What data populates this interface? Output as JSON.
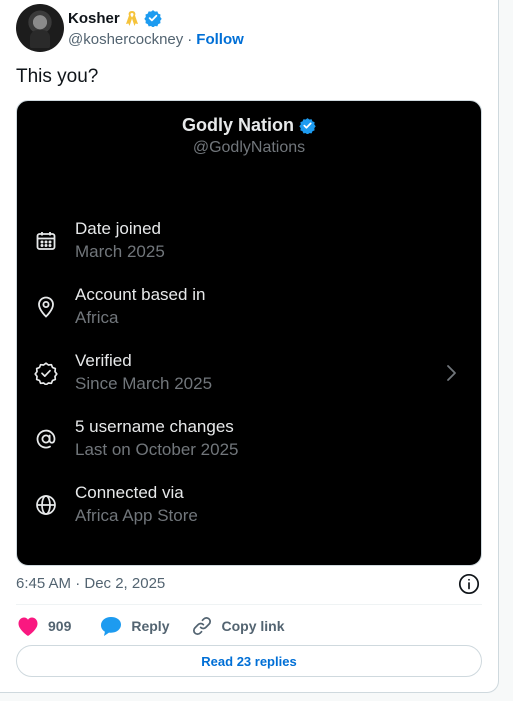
{
  "author": {
    "display_name": "Kosher",
    "handle": "@koshercockney",
    "separator": "·",
    "follow_label": "Follow"
  },
  "tweet": {
    "text": "This you?",
    "timestamp": "6:45 AM · Dec 2, 2025"
  },
  "media": {
    "profile_name": "Godly Nation",
    "profile_handle": "@GodlyNations",
    "items": [
      {
        "icon": "calendar-icon",
        "title": "Date joined",
        "subtitle": "March 2025"
      },
      {
        "icon": "location-pin-icon",
        "title": "Account based in",
        "subtitle": "Africa"
      },
      {
        "icon": "verified-badge-icon",
        "title": "Verified",
        "subtitle": "Since March 2025"
      },
      {
        "icon": "at-sign-icon",
        "title": "5 username changes",
        "subtitle": "Last on October 2025"
      },
      {
        "icon": "globe-icon",
        "title": "Connected via",
        "subtitle": "Africa App Store"
      }
    ]
  },
  "actions": {
    "like_count": "909",
    "reply_label": "Reply",
    "copy_link_label": "Copy link",
    "read_replies_label": "Read 23 replies"
  },
  "colors": {
    "accent_blue": "#1d9bf0",
    "link_blue": "#006fd6",
    "like_pink": "#f91880",
    "ribbon_gold": "#f5c33b"
  }
}
